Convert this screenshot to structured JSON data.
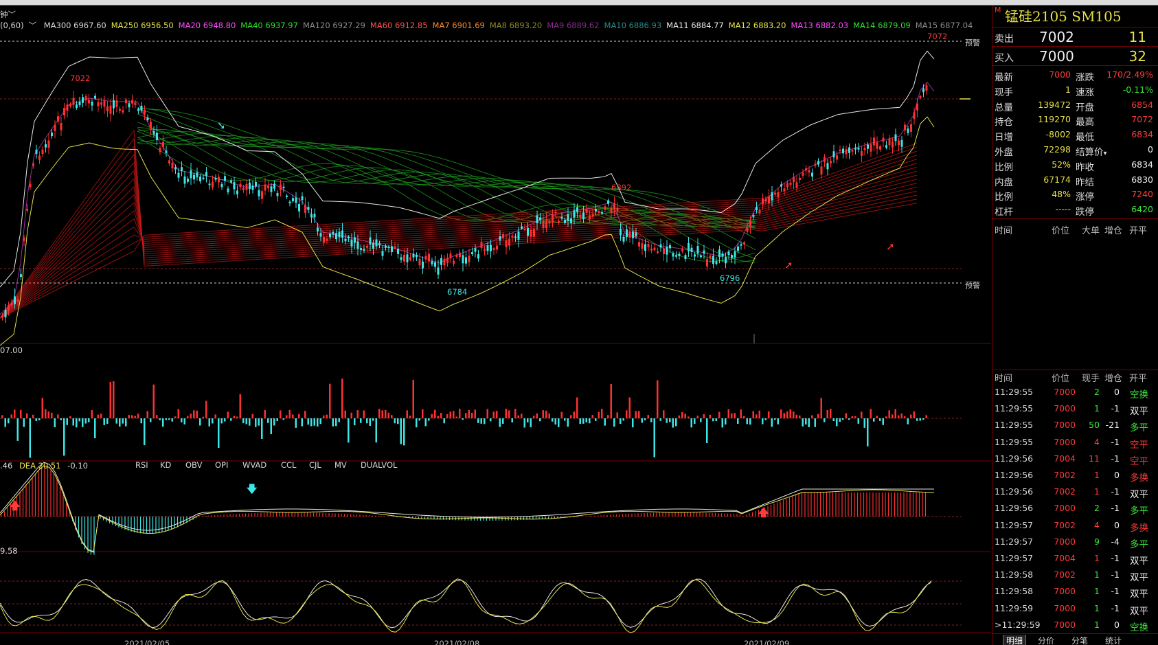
{
  "top_left": {
    "period_label": "钟",
    "macd_params": "(0,60)",
    "vol_max": "07.00",
    "macd_values": {
      "diff": ".46",
      "dea_label": "DEA",
      "dea": "20.51",
      "macd": "-0.10"
    },
    "rsi_value": "9.58"
  },
  "ma_legend": [
    {
      "label": "MA300",
      "value": "6967.60",
      "color": "#d8d8d8"
    },
    {
      "label": "MA250",
      "value": "6956.50",
      "color": "#e6e34a"
    },
    {
      "label": "MA20",
      "value": "6948.80",
      "color": "#ff4dff"
    },
    {
      "label": "MA40",
      "value": "6937.97",
      "color": "#2de02d"
    },
    {
      "label": "MA120",
      "value": "6927.29",
      "color": "#8a8a8a"
    },
    {
      "label": "MA60",
      "value": "6912.85",
      "color": "#ff5050"
    },
    {
      "label": "MA7",
      "value": "6901.69",
      "color": "#ff8a2a"
    },
    {
      "label": "MA8",
      "value": "6893.20",
      "color": "#8a8a2a"
    },
    {
      "label": "MA9",
      "value": "6889.62",
      "color": "#8a2a8a"
    },
    {
      "label": "MA10",
      "value": "6886.93",
      "color": "#2a8a8a"
    },
    {
      "label": "MA11",
      "value": "6884.77",
      "color": "#e8e8e8"
    },
    {
      "label": "MA12",
      "value": "6883.20",
      "color": "#e6e34a"
    },
    {
      "label": "MA13",
      "value": "6882.03",
      "color": "#ff4dff"
    },
    {
      "label": "MA14",
      "value": "6879.09",
      "color": "#2de02d"
    },
    {
      "label": "MA15",
      "value": "6877.04",
      "color": "#8a8a8a"
    }
  ],
  "chart_labels": {
    "warning": "预警",
    "high_left": "7022",
    "low_mid": "6784",
    "high_mid": "6892",
    "low_right": "6796",
    "high_right": "7072"
  },
  "indicator_tabs": [
    "RSI",
    "KD",
    "OBV",
    "OPI",
    "WVAD",
    "CCL",
    "CJL",
    "MV",
    "DUALVOL"
  ],
  "dates": [
    "2021/02/05",
    "2021/02/08",
    "2021/02/09"
  ],
  "colors": {
    "up": "#ff3030",
    "down": "#3ee6e6",
    "grid": "#7a0000",
    "accent": "#e8e04a"
  },
  "panel": {
    "m_badge": "M",
    "title": "锰硅2105  SM105",
    "sell": {
      "label": "卖出",
      "price": "7002",
      "volume": "11"
    },
    "buy": {
      "label": "买入",
      "price": "7000",
      "volume": "32"
    },
    "quote": [
      {
        "l1": "最新",
        "v1": "7000",
        "c1": "#ff3a3a",
        "l2": "涨跌",
        "v2": "170/2.49%",
        "c2": "#ff3a3a"
      },
      {
        "l1": "现手",
        "v1": "1",
        "c1": "#e8e04a",
        "l2": "速涨",
        "v2": "-0.11%",
        "c2": "#3ee63e"
      },
      {
        "l1": "总量",
        "v1": "139472",
        "c1": "#e8e04a",
        "l2": "开盘",
        "v2": "6854",
        "c2": "#ff3a3a"
      },
      {
        "l1": "持仓",
        "v1": "119270",
        "c1": "#e8e04a",
        "l2": "最高",
        "v2": "7072",
        "c2": "#ff3a3a"
      },
      {
        "l1": "日增",
        "v1": "-8002",
        "c1": "#e8e04a",
        "l2": "最低",
        "v2": "6834",
        "c2": "#ff3a3a"
      },
      {
        "l1": "外盘",
        "v1": "72298",
        "c1": "#e8e04a",
        "l2": "结算价",
        "v2": "0",
        "c2": "#f0f0f0"
      },
      {
        "l1": "比例",
        "v1": "52%",
        "c1": "#e8e04a",
        "l2": "昨收",
        "v2": "6834",
        "c2": "#f0f0f0"
      },
      {
        "l1": "内盘",
        "v1": "67174",
        "c1": "#e8e04a",
        "l2": "昨结",
        "v2": "6830",
        "c2": "#f0f0f0"
      },
      {
        "l1": "比例",
        "v1": "48%",
        "c1": "#e8e04a",
        "l2": "涨停",
        "v2": "7240",
        "c2": "#ff3a3a"
      },
      {
        "l1": "杠杆",
        "v1": "-----",
        "c1": "#e8e04a",
        "l2": "跌停",
        "v2": "6420",
        "c2": "#3ee63e"
      }
    ],
    "settle_arrow": "▾",
    "big_head": [
      "时间",
      "价位",
      "大单",
      "增仓",
      "开平"
    ],
    "trade_head": [
      "时间",
      "价位",
      "现手",
      "增仓",
      "开平"
    ],
    "trades": [
      {
        "time": "11:29:55",
        "price": "7000",
        "hand": "2",
        "hcolor": "#3ee63e",
        "chg": "0",
        "kp": "空换",
        "kcolor": "#3ee63e"
      },
      {
        "time": "11:29:55",
        "price": "7000",
        "hand": "1",
        "hcolor": "#3ee63e",
        "chg": "-1",
        "kp": "双平",
        "kcolor": "#f0f0f0"
      },
      {
        "time": "11:29:55",
        "price": "7000",
        "hand": "50",
        "hcolor": "#3ee63e",
        "chg": "-21",
        "kp": "多平",
        "kcolor": "#3ee63e"
      },
      {
        "time": "11:29:55",
        "price": "7000",
        "hand": "4",
        "hcolor": "#ff3a3a",
        "chg": "-1",
        "kp": "空平",
        "kcolor": "#ff3a3a"
      },
      {
        "time": "11:29:56",
        "price": "7004",
        "hand": "11",
        "hcolor": "#ff3a3a",
        "chg": "-1",
        "kp": "空平",
        "kcolor": "#ff3a3a"
      },
      {
        "time": "11:29:56",
        "price": "7002",
        "hand": "1",
        "hcolor": "#ff3a3a",
        "chg": "0",
        "kp": "多换",
        "kcolor": "#ff3a3a"
      },
      {
        "time": "11:29:56",
        "price": "7002",
        "hand": "1",
        "hcolor": "#ff3a3a",
        "chg": "-1",
        "kp": "双平",
        "kcolor": "#f0f0f0"
      },
      {
        "time": "11:29:56",
        "price": "7000",
        "hand": "2",
        "hcolor": "#3ee63e",
        "chg": "-1",
        "kp": "多平",
        "kcolor": "#3ee63e"
      },
      {
        "time": "11:29:57",
        "price": "7002",
        "hand": "4",
        "hcolor": "#ff3a3a",
        "chg": "0",
        "kp": "多换",
        "kcolor": "#ff3a3a"
      },
      {
        "time": "11:29:57",
        "price": "7000",
        "hand": "9",
        "hcolor": "#3ee63e",
        "chg": "-4",
        "kp": "多平",
        "kcolor": "#3ee63e"
      },
      {
        "time": "11:29:57",
        "price": "7004",
        "hand": "1",
        "hcolor": "#ff3a3a",
        "chg": "-1",
        "kp": "双平",
        "kcolor": "#f0f0f0"
      },
      {
        "time": "11:29:58",
        "price": "7002",
        "hand": "1",
        "hcolor": "#3ee63e",
        "chg": "-1",
        "kp": "双平",
        "kcolor": "#f0f0f0"
      },
      {
        "time": "11:29:58",
        "price": "7000",
        "hand": "1",
        "hcolor": "#3ee63e",
        "chg": "-1",
        "kp": "双平",
        "kcolor": "#f0f0f0"
      },
      {
        "time": "11:29:59",
        "price": "7000",
        "hand": "1",
        "hcolor": "#3ee63e",
        "chg": "-1",
        "kp": "双平",
        "kcolor": "#f0f0f0"
      },
      {
        "time": ">11:29:59",
        "price": "7000",
        "hand": "1",
        "hcolor": "#3ee63e",
        "chg": "0",
        "kp": "空换",
        "kcolor": "#3ee63e"
      }
    ],
    "bottom_tabs": [
      "明细",
      "分价",
      "分笔",
      "统计"
    ]
  }
}
